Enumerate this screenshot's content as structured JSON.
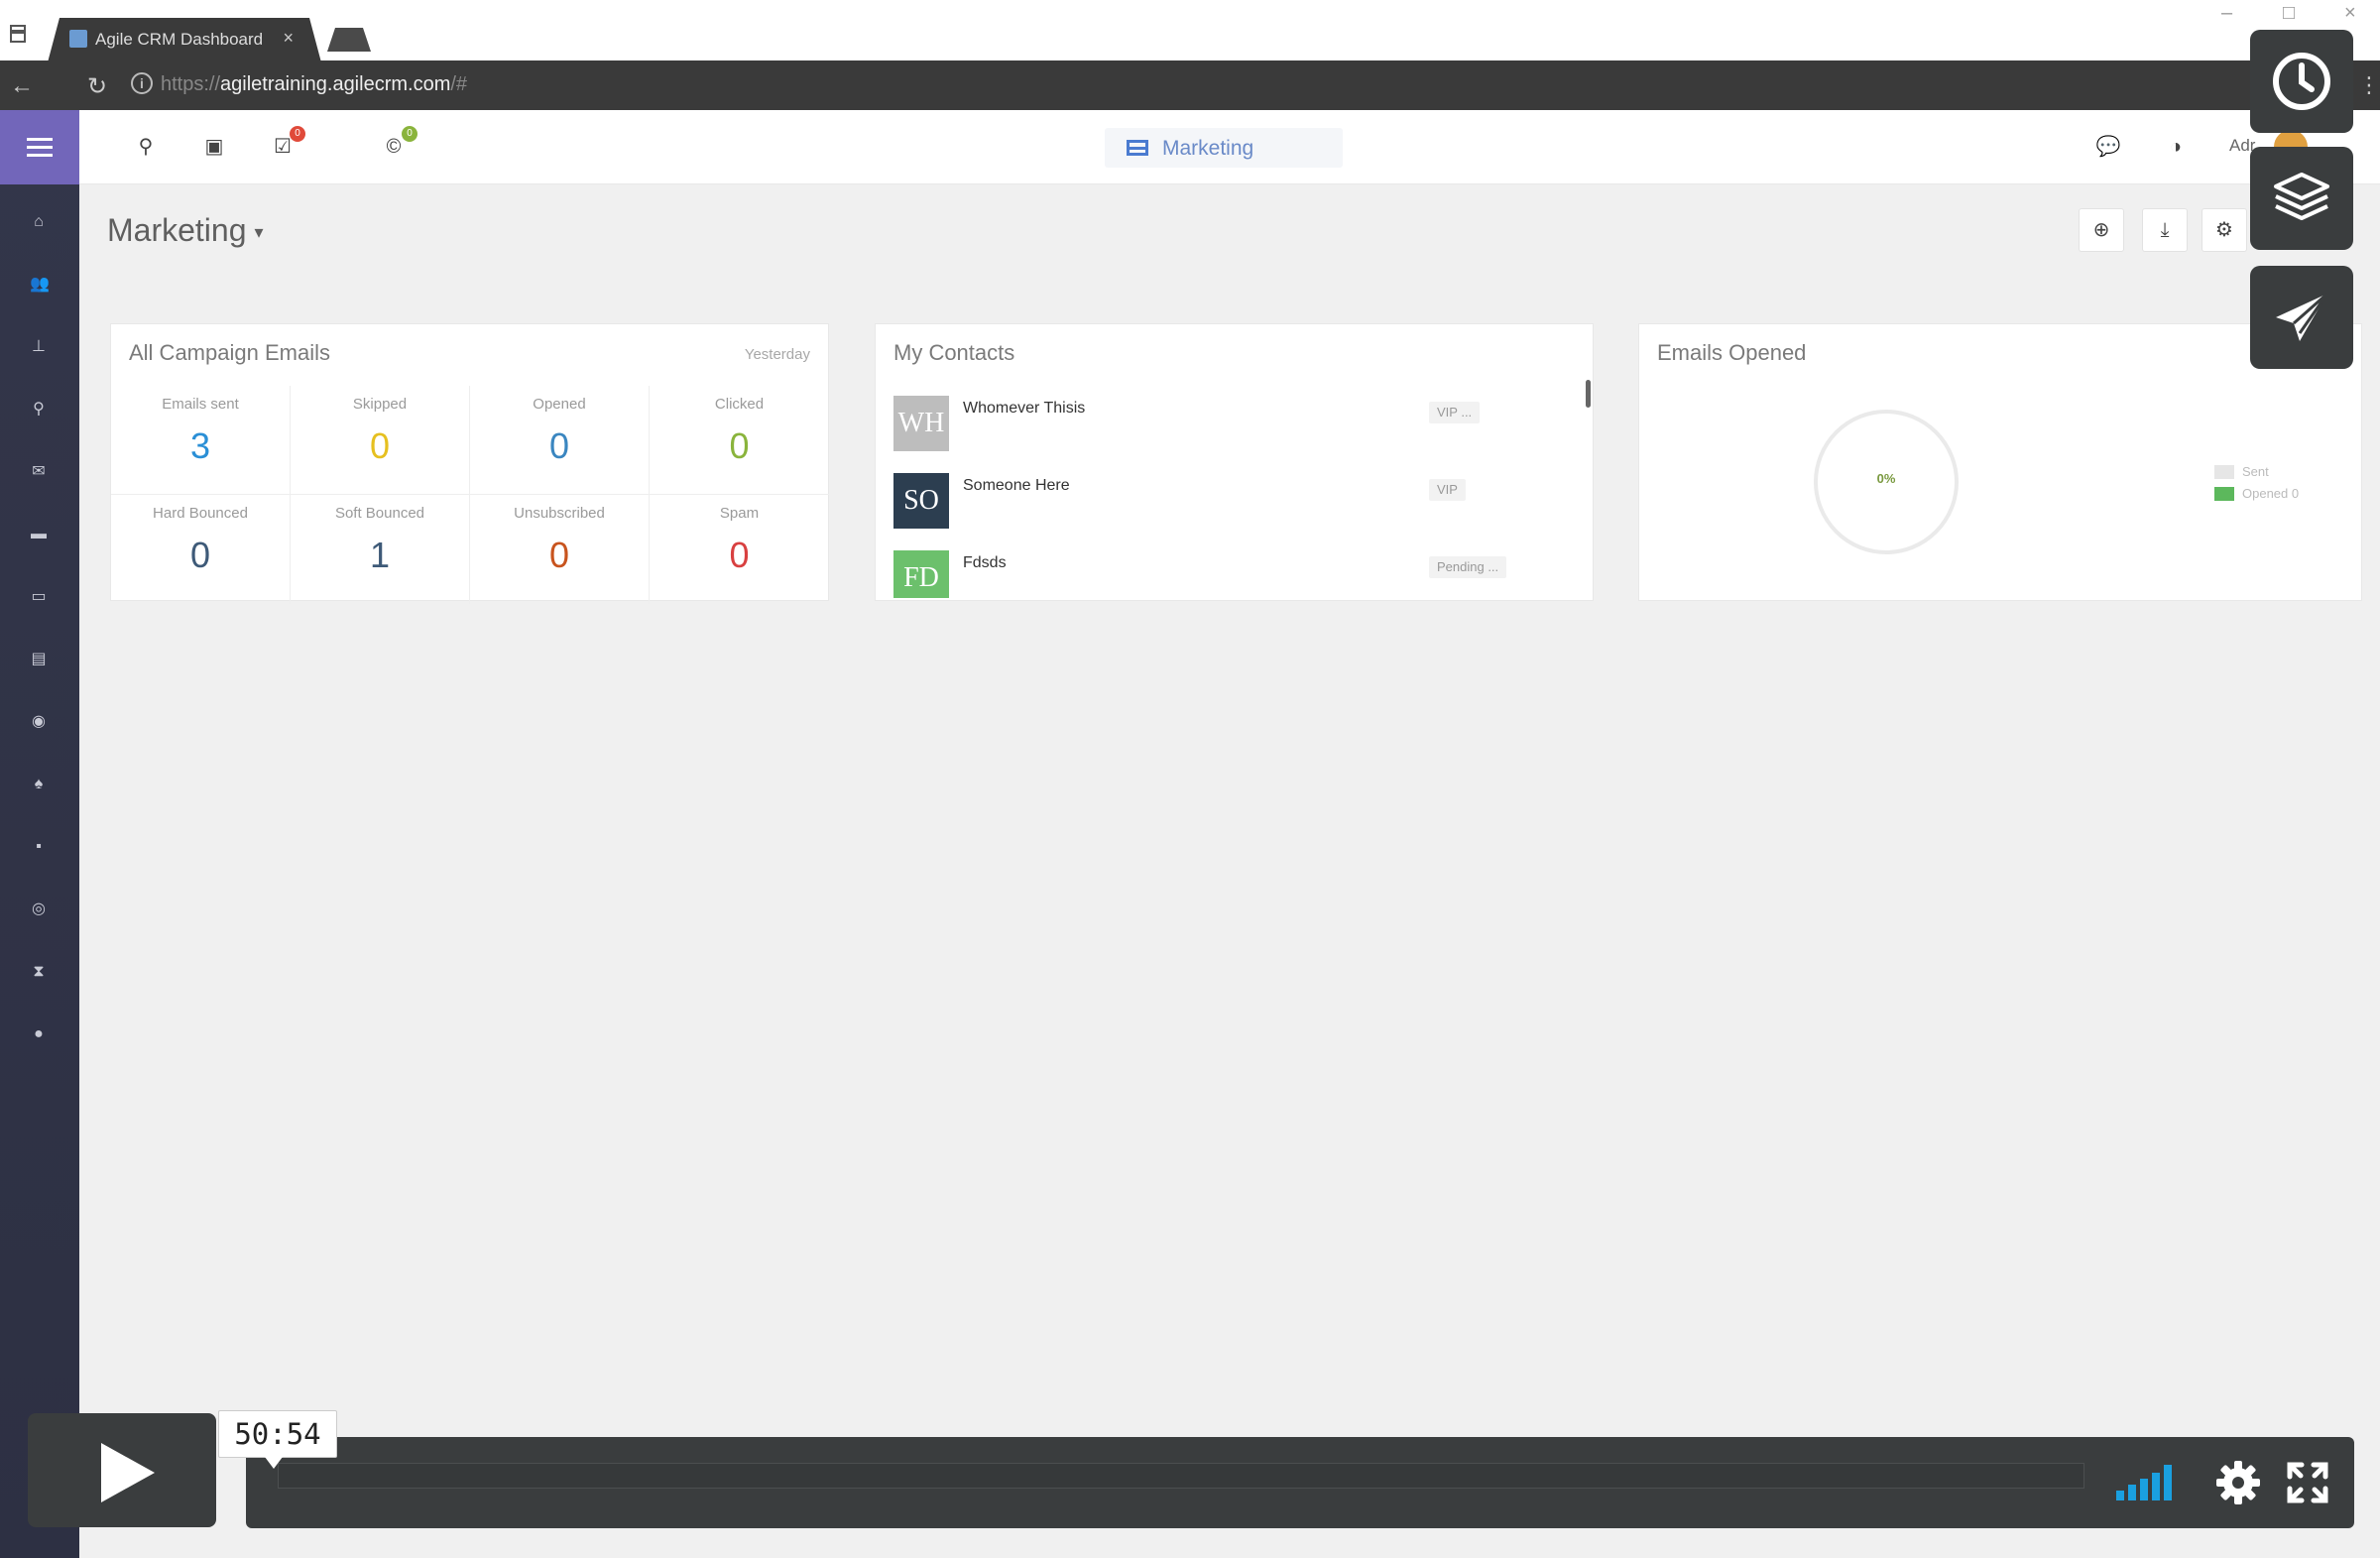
{
  "browser": {
    "tab_title": "Agile CRM Dashboard",
    "tab_close": "×",
    "url_scheme": "https://",
    "url_host": "agiletraining.agilecrm.com",
    "url_rest": "/#"
  },
  "header": {
    "center_tab_label": "Marketing",
    "user_menu_label": "Adr",
    "badges": {
      "tasks": "0",
      "contacts": "0"
    }
  },
  "page": {
    "title": "Marketing",
    "caret": "▾"
  },
  "campaign_emails": {
    "title": "All Campaign Emails",
    "period": "Yesterday",
    "stats": [
      {
        "label": "Emails sent",
        "value": "3",
        "color": "#2a8fd6"
      },
      {
        "label": "Skipped",
        "value": "0",
        "color": "#e6c020"
      },
      {
        "label": "Opened",
        "value": "0",
        "color": "#3a86c0"
      },
      {
        "label": "Clicked",
        "value": "0",
        "color": "#8ab43c"
      },
      {
        "label": "Hard Bounced",
        "value": "0",
        "color": "#3e5a78"
      },
      {
        "label": "Soft Bounced",
        "value": "1",
        "color": "#3e5a78"
      },
      {
        "label": "Unsubscribed",
        "value": "0",
        "color": "#c8541e"
      },
      {
        "label": "Spam",
        "value": "0",
        "color": "#d84040"
      }
    ]
  },
  "my_contacts": {
    "title": "My Contacts",
    "items": [
      {
        "initials": "WH",
        "name": "Whomever Thisis",
        "tag": "VIP ...",
        "avatar_color": "#bdbdbd"
      },
      {
        "initials": "SO",
        "name": "Someone Here",
        "tag": "VIP",
        "avatar_color": "#2c3e50"
      },
      {
        "initials": "FD",
        "name": "Fdsds",
        "tag": "Pending ...",
        "avatar_color": "#6cc06c"
      }
    ]
  },
  "emails_opened": {
    "title": "Emails Opened",
    "center_text": "0%",
    "legend": [
      {
        "label": "Sent",
        "color": "#e6e6e6"
      },
      {
        "label": "Opened 0",
        "color": "#5cb85c"
      }
    ]
  },
  "video": {
    "time": "50:54"
  }
}
